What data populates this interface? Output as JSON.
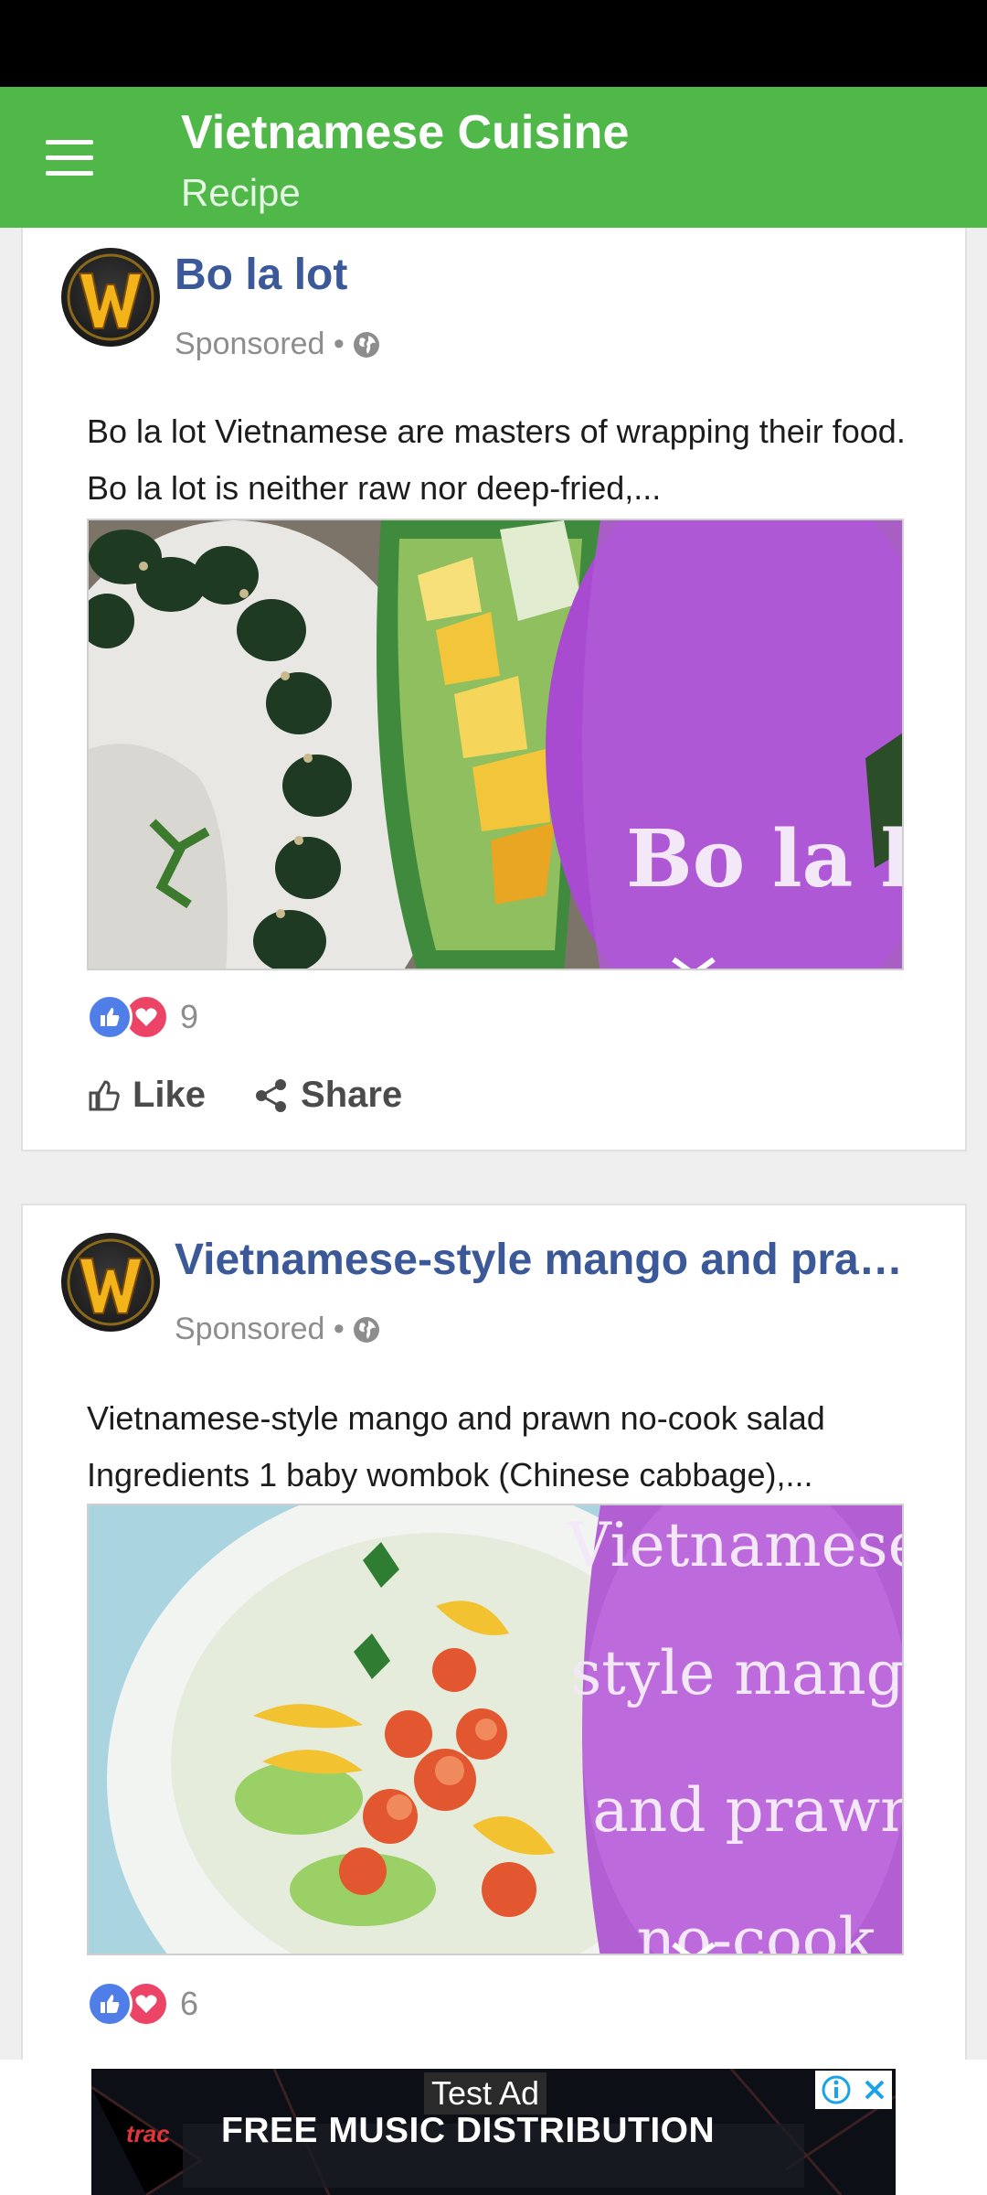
{
  "app": {
    "title": "Vietnamese Cuisine",
    "subtitle": "Recipe"
  },
  "posts": [
    {
      "title": "Bo la lot",
      "sponsored": "Sponsored •",
      "text": " Bo la lot Vietnamese are masters of wrapping their food. Bo la lot is neither raw nor deep-fried,...",
      "image_caption": "Bo la lot",
      "reaction_count": "9",
      "like_label": "Like",
      "share_label": "Share"
    },
    {
      "title": "Vietnamese-style mango and praw…",
      "sponsored": "Sponsored •",
      "text": "Vietnamese-style mango and prawn no-cook salad Ingredients 1 baby wombok (Chinese cabbage),...",
      "image_caption_lines": [
        "Vietnamese-",
        "style mango",
        "and prawn",
        "no-cook"
      ],
      "reaction_count": "6"
    }
  ],
  "ad": {
    "label": "Test Ad",
    "logo": "trac",
    "headline": "FREE MUSIC DISTRIBUTION"
  },
  "icons": [
    "menu-icon",
    "globe-icon",
    "like-reaction-icon",
    "love-reaction-icon",
    "thumbs-up-icon",
    "share-icon",
    "chevron-down-icon",
    "adchoices-info-icon",
    "close-icon"
  ],
  "colors": {
    "appbar": "#4fb849",
    "title_link": "#3b5998",
    "like": "#4f7ee8",
    "love": "#ec4466"
  }
}
